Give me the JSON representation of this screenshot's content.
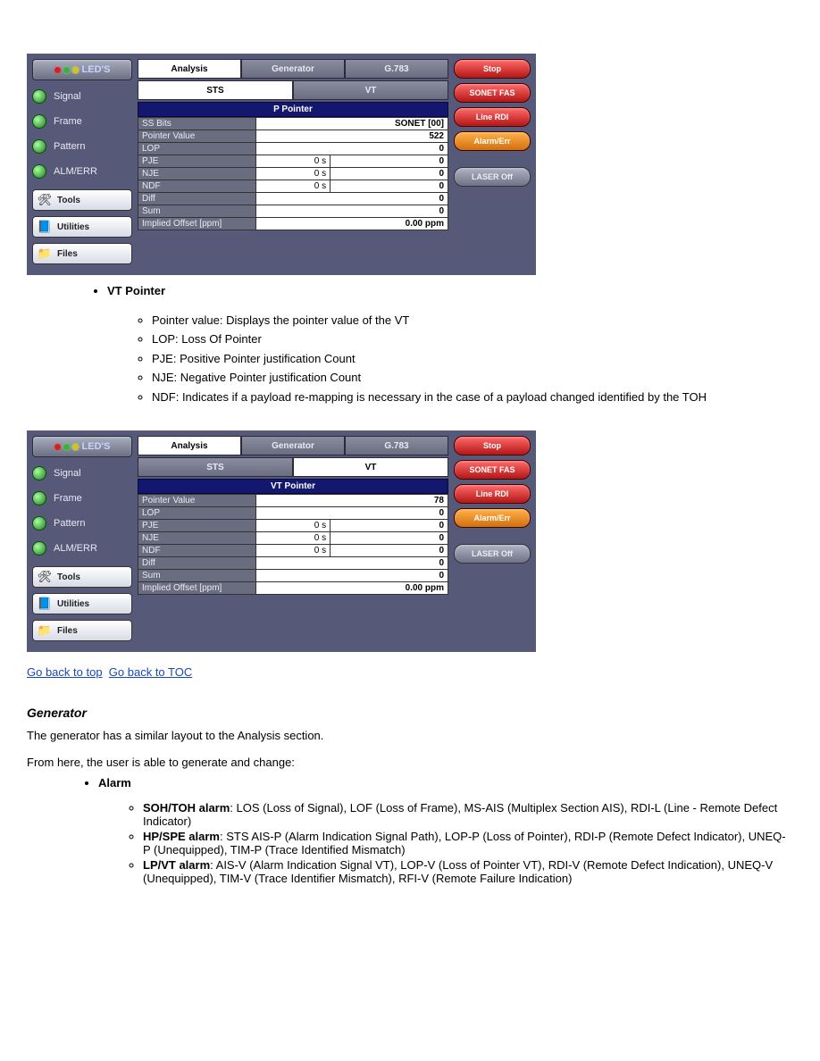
{
  "screenshot1": {
    "leds_label": "LED'S",
    "led_items": [
      "Signal",
      "Frame",
      "Pattern",
      "ALM/ERR"
    ],
    "tools": [
      "Tools",
      "Utilities",
      "Files"
    ],
    "tabs_top": [
      "Analysis",
      "Generator",
      "G.783"
    ],
    "tabs_top_active": 0,
    "tabs_sub": [
      "STS",
      "VT"
    ],
    "tabs_sub_active": 0,
    "section_header": "P Pointer",
    "rows": [
      {
        "label": "SS Bits",
        "mid": "",
        "val": "SONET [00]"
      },
      {
        "label": "Pointer Value",
        "mid": "",
        "val": "522"
      },
      {
        "label": "LOP",
        "mid": "",
        "val": "0"
      },
      {
        "label": "PJE",
        "mid": "0 s",
        "val": "0"
      },
      {
        "label": "NJE",
        "mid": "0 s",
        "val": "0"
      },
      {
        "label": "NDF",
        "mid": "0 s",
        "val": "0"
      },
      {
        "label": "Diff",
        "mid": "",
        "val": "0"
      },
      {
        "label": "Sum",
        "mid": "",
        "val": "0"
      },
      {
        "label": "Implied Offset [ppm]",
        "mid": "",
        "val": "0.00 ppm"
      }
    ],
    "right_buttons": [
      {
        "label": "Stop",
        "style": "red"
      },
      {
        "label": "SONET FAS",
        "style": "red"
      },
      {
        "label": "Line RDI",
        "style": "red"
      },
      {
        "label": "Alarm/Err",
        "style": "orange"
      },
      {
        "label": "LASER Off",
        "style": "grey"
      }
    ]
  },
  "bullets_vt": {
    "title": "VT Pointer",
    "items": [
      "Pointer value: Displays the pointer value of the VT",
      "LOP: Loss Of Pointer",
      "PJE: Positive Pointer justification Count",
      "NJE: Negative Pointer justification Count",
      "NDF: Indicates if a payload re-mapping is necessary in the case of a payload changed identified by the TOH"
    ]
  },
  "screenshot2": {
    "leds_label": "LED'S",
    "led_items": [
      "Signal",
      "Frame",
      "Pattern",
      "ALM/ERR"
    ],
    "tools": [
      "Tools",
      "Utilities",
      "Files"
    ],
    "tabs_top": [
      "Analysis",
      "Generator",
      "G.783"
    ],
    "tabs_top_active": 0,
    "tabs_sub": [
      "STS",
      "VT"
    ],
    "tabs_sub_active": 1,
    "section_header": "VT Pointer",
    "rows": [
      {
        "label": "Pointer Value",
        "mid": "",
        "val": "78"
      },
      {
        "label": "LOP",
        "mid": "",
        "val": "0"
      },
      {
        "label": "PJE",
        "mid": "0 s",
        "val": "0"
      },
      {
        "label": "NJE",
        "mid": "0 s",
        "val": "0"
      },
      {
        "label": "NDF",
        "mid": "0 s",
        "val": "0"
      },
      {
        "label": "Diff",
        "mid": "",
        "val": "0"
      },
      {
        "label": "Sum",
        "mid": "",
        "val": "0"
      },
      {
        "label": "Implied Offset [ppm]",
        "mid": "",
        "val": "0.00 ppm"
      }
    ],
    "right_buttons": [
      {
        "label": "Stop",
        "style": "red"
      },
      {
        "label": "SONET FAS",
        "style": "red"
      },
      {
        "label": "Line RDI",
        "style": "red"
      },
      {
        "label": "Alarm/Err",
        "style": "orange"
      },
      {
        "label": "LASER Off",
        "style": "grey"
      }
    ]
  },
  "anchor_link": {
    "text": "Go back to top",
    "second": "Go back to TOC"
  },
  "generator": {
    "title": "Generator",
    "intro_1": "The generator has a similar layout to the Analysis section.",
    "intro_2": "From here, the user is able to generate and change:",
    "alarm_heading": "Alarm",
    "alarm_items": [
      {
        "bold": "SOH/TOH alarm",
        "text": "**LOS (Loss of Signal), LOF (Loss of Frame), MS-AIS (Multiplex Section AIS), RDI-L (Line - Remote Defect Indicator)"
      },
      {
        "bold": "HP/SPE alarm",
        "text": "**STS AIS-P (Alarm Indication Signal Path), LOP-P (Loss of Pointer), RDI-P (Remote Defect Indicator), UNEQ-P (Unequipped), TIM-P (Trace Identified Mismatch)"
      },
      {
        "bold": "LP/VT alarm",
        "text": "**AIS-V (Alarm Indication Signal VT), LOP-V (Loss of Pointer VT), RDI-V (Remote Defect Indication), UNEQ-V (Unequipped), TIM-V (Trace Identifier Mismatch), RFI-V (Remote Failure Indication)"
      }
    ]
  },
  "icons": {
    "tools": "🔧",
    "utilities": "📘",
    "files": "📁"
  }
}
